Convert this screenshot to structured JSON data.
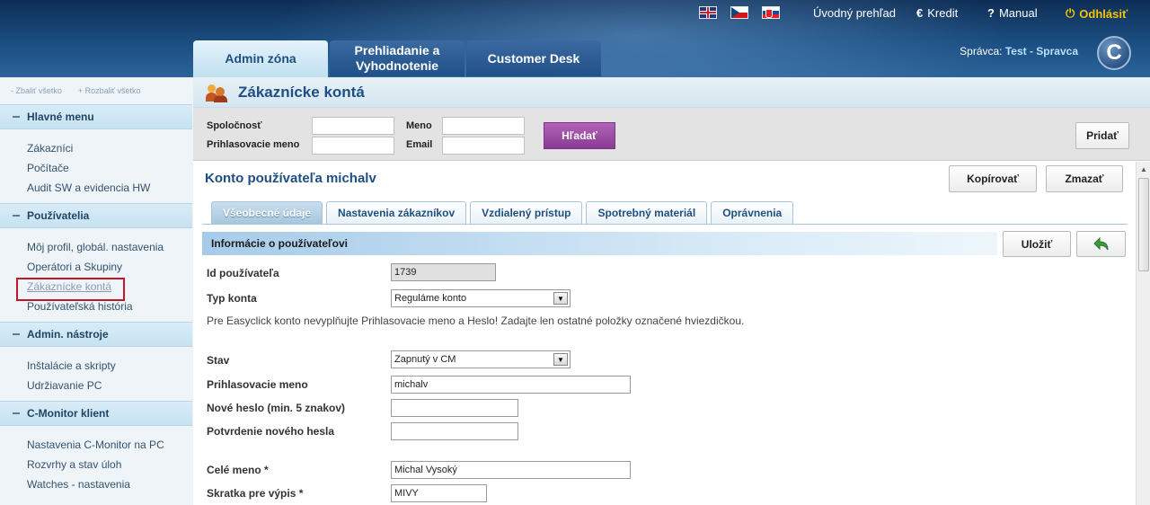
{
  "header": {
    "flags": [
      "flag-uk-icon",
      "flag-cz-icon",
      "flag-sk-icon"
    ],
    "links": {
      "overview": "Úvodný prehľad",
      "credit": "Kredit",
      "manual": "Manual",
      "logout": "Odhlásiť"
    },
    "tabs": [
      "Admin zóna",
      "Prehliadanie a Vyhodnotenie",
      "Customer Desk"
    ],
    "admin_label": "Správca:",
    "admin_name": "Test - Spravca",
    "logo_letter": "C"
  },
  "sidebar": {
    "collapse_all": "- Zbaliť všetko",
    "expand_all": "+ Rozbaliť všetko",
    "sections": [
      {
        "title": "Hlavné menu",
        "items": [
          "Zákazníci",
          "Počítače",
          "Audit SW a evidencia HW"
        ]
      },
      {
        "title": "Používatelia",
        "items": [
          "Môj profil, globál. nastavenia",
          "Operátori a Skupiny",
          "Zákaznícke kontá",
          "Používateľská história"
        ]
      },
      {
        "title": "Admin. nástroje",
        "items": [
          "Inštalácie a skripty",
          "Udržiavanie PC"
        ]
      },
      {
        "title": "C-Monitor klient",
        "items": [
          "Nastavenia C-Monitor na PC",
          "Rozvrhy a stav úloh",
          "Watches - nastavenia"
        ]
      }
    ],
    "active_item": "Zákaznícke kontá"
  },
  "page": {
    "title": "Zákaznícke kontá",
    "search": {
      "company_label": "Spoločnosť",
      "login_label": "Prihlasovacie meno",
      "name_label": "Meno",
      "email_label": "Email",
      "search_button": "Hľadať",
      "add_button": "Pridať"
    },
    "account_title": "Konto používateľa michalv",
    "copy_button": "Kopírovať",
    "delete_button": "Zmazať",
    "subtabs": [
      "Všeobecné údaje",
      "Nastavenia zákazníkov",
      "Vzdialený prístup",
      "Spotrebný materiál",
      "Oprávnenia"
    ],
    "active_subtab": "Všeobecné údaje",
    "section_title": "Informácie o používateľovi",
    "save_button": "Uložiť",
    "back_icon": "back-arrow-icon",
    "fields": {
      "user_id_label": "Id používateľa",
      "user_id": "1739",
      "account_type_label": "Typ konta",
      "account_type": "Reguláme konto",
      "note": "Pre Easyclick konto nevyplňujte Prihlasovacie meno a Heslo! Zadajte len ostatné položky označené hviezdičkou.",
      "status_label": "Stav",
      "status": "Zapnutý v CM",
      "login_label": "Prihlasovacie meno",
      "login": "michalv",
      "new_password_label": "Nové heslo (min. 5 znakov)",
      "new_password": "",
      "confirm_password_label": "Potvrdenie nového hesla",
      "confirm_password": "",
      "full_name_label": "Celé meno *",
      "full_name": "Michal Vysoký",
      "abbrev_label": "Skratka pre výpis *",
      "abbrev": "MIVY"
    }
  },
  "colors": {
    "accent": "#1f4f82",
    "search_button": "#9a4aa4",
    "logout": "#f5c400",
    "highlight_border": "#c3172b"
  }
}
